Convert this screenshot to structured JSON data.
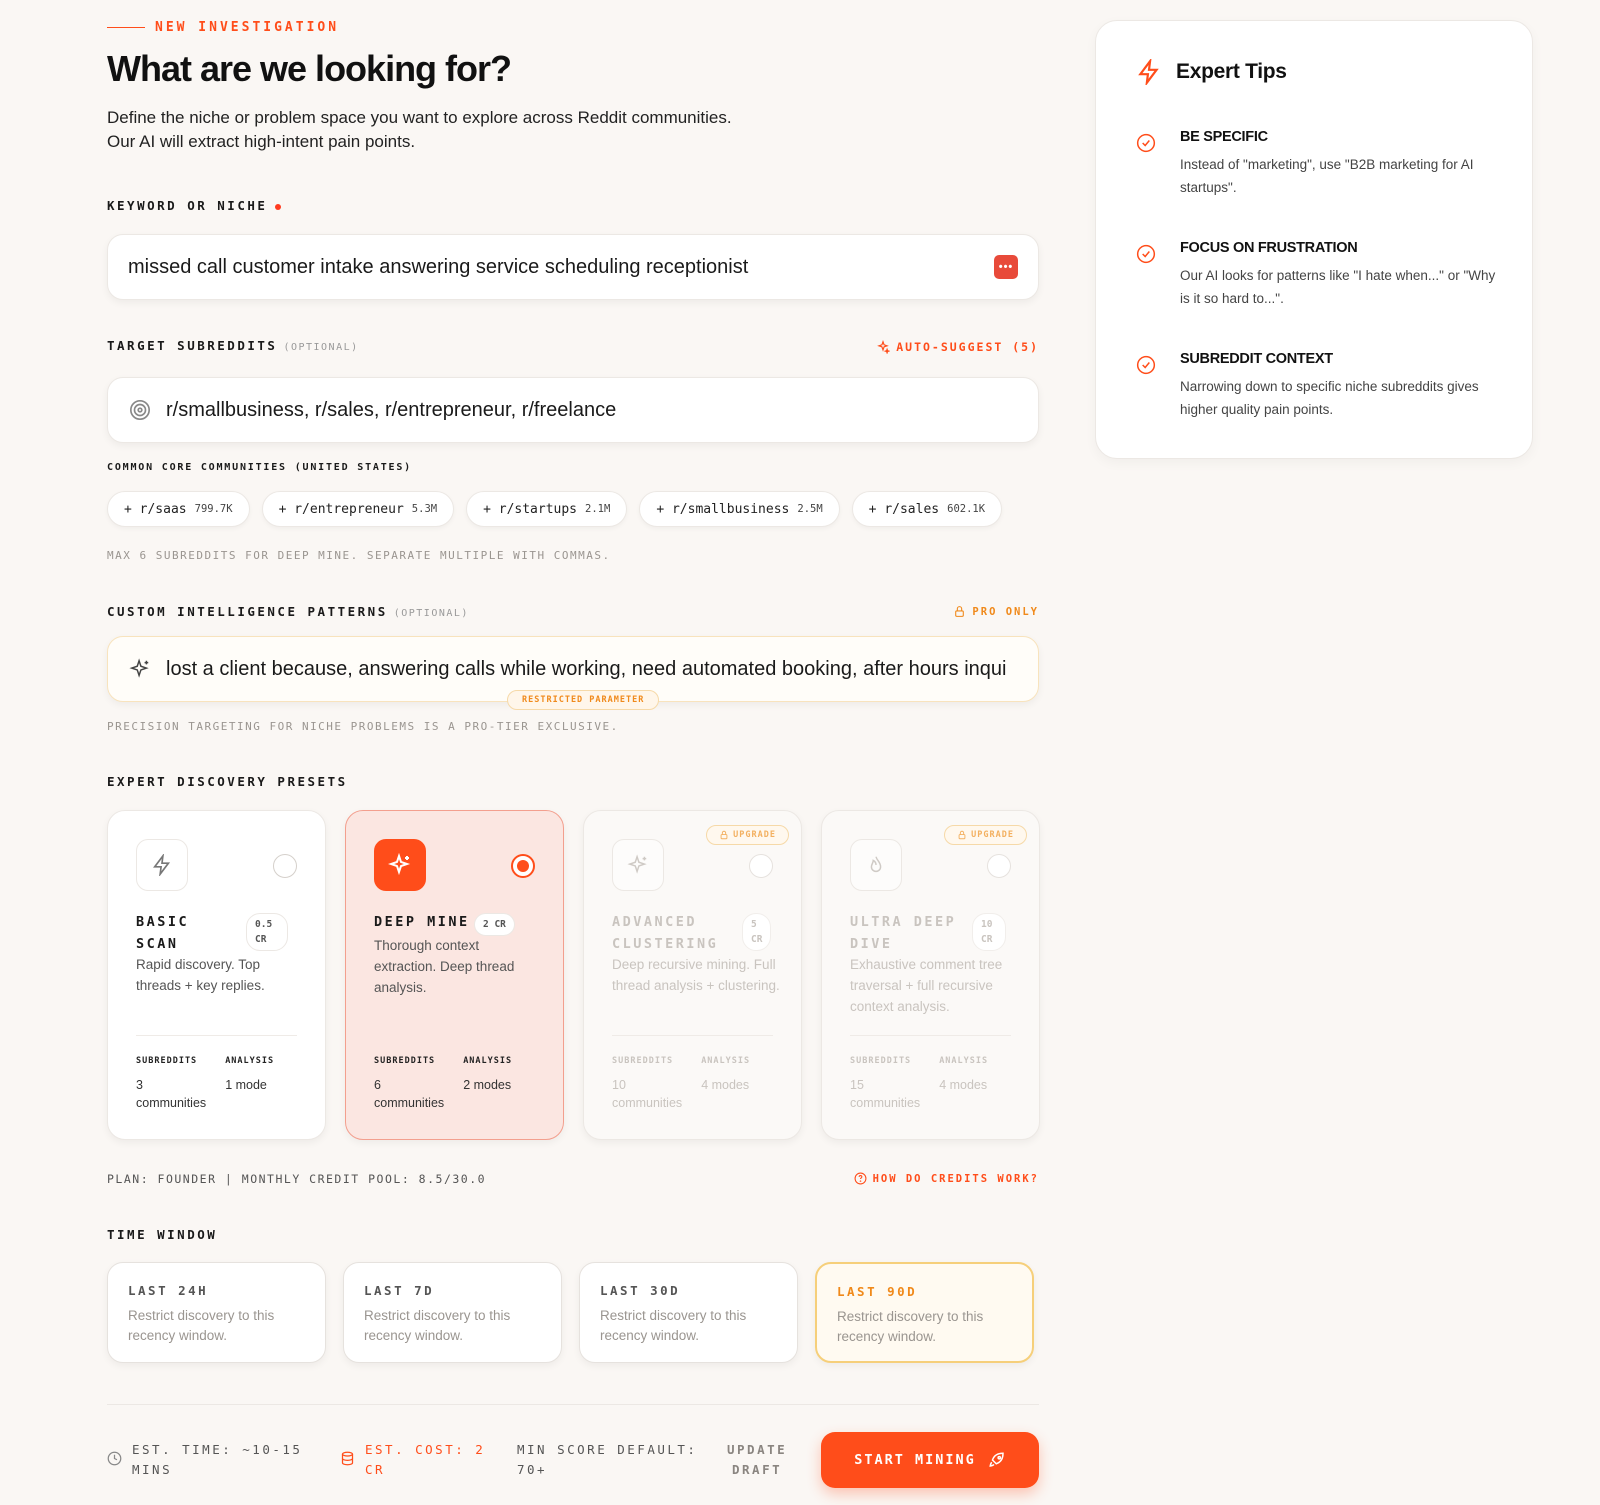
{
  "header": {
    "eyebrow": "NEW INVESTIGATION",
    "title": "What are we looking for?",
    "subtitle_line1": "Define the niche or problem space you want to explore across Reddit communities.",
    "subtitle_line2": "Our AI will extract high-intent pain points."
  },
  "keyword": {
    "label": "KEYWORD OR NICHE",
    "value": "missed call customer intake answering service scheduling receptionist",
    "badge": "•••"
  },
  "subreddits": {
    "label": "TARGET SUBREDDITS",
    "optional": "(OPTIONAL)",
    "auto_suggest": "AUTO-SUGGEST (5)",
    "value": "r/smallbusiness, r/sales, r/entrepreneur, r/freelance",
    "common_label": "COMMON CORE COMMUNITIES (UNITED STATES)",
    "chips": [
      {
        "name": "+ r/saas",
        "count": "799.7K"
      },
      {
        "name": "+ r/entrepreneur",
        "count": "5.3M"
      },
      {
        "name": "+ r/startups",
        "count": "2.1M"
      },
      {
        "name": "+ r/smallbusiness",
        "count": "2.5M"
      },
      {
        "name": "+ r/sales",
        "count": "602.1K"
      }
    ],
    "note": "MAX 6 SUBREDDITS FOR DEEP MINE. SEPARATE MULTIPLE WITH COMMAS."
  },
  "patterns": {
    "label": "CUSTOM INTELLIGENCE PATTERNS",
    "optional": "(OPTIONAL)",
    "pro_only": "PRO ONLY",
    "value": "lost a client because, answering calls while working, need automated booking, after hours inqui",
    "restricted": "RESTRICTED PARAMETER",
    "note": "PRECISION TARGETING FOR NICHE PROBLEMS IS A PRO-TIER EXCLUSIVE."
  },
  "presets": {
    "label": "EXPERT DISCOVERY PRESETS",
    "cards": [
      {
        "title1": "BASIC",
        "title2": "SCAN",
        "cr1": "0.5",
        "cr2": "CR",
        "desc": "Rapid discovery. Top threads + key replies.",
        "k1": "SUBREDDITS",
        "v1a": "3",
        "v1b": "communities",
        "k2": "ANALYSIS",
        "v2": "1 mode"
      },
      {
        "title1": "DEEP MINE",
        "title2": "",
        "cr1": "2 CR",
        "cr2": "",
        "desc": "Thorough context extraction. Deep thread analysis.",
        "k1": "SUBREDDITS",
        "v1a": "6",
        "v1b": "communities",
        "k2": "ANALYSIS",
        "v2": "2 modes"
      },
      {
        "title1": "ADVANCED",
        "title2": "CLUSTERING",
        "cr1": "5",
        "cr2": "CR",
        "desc": "Deep recursive mining. Full thread analysis + clustering.",
        "k1": "SUBREDDITS",
        "v1a": "10",
        "v1b": "communities",
        "k2": "ANALYSIS",
        "v2": "4 modes",
        "upgrade": "UPGRADE"
      },
      {
        "title1": "ULTRA DEEP",
        "title2": "DIVE",
        "cr1": "10",
        "cr2": "CR",
        "desc": "Exhaustive comment tree traversal + full recursive context analysis.",
        "k1": "SUBREDDITS",
        "v1a": "15",
        "v1b": "communities",
        "k2": "ANALYSIS",
        "v2": "4 modes",
        "upgrade": "UPGRADE"
      }
    ]
  },
  "plan": {
    "text": "PLAN: FOUNDER | MONTHLY CREDIT POOL: 8.5/30.0",
    "credits_link": "HOW DO CREDITS WORK?"
  },
  "time_window": {
    "label": "TIME WINDOW",
    "options": [
      {
        "title": "LAST 24H",
        "desc": "Restrict discovery to this recency window."
      },
      {
        "title": "LAST 7D",
        "desc": "Restrict discovery to this recency window."
      },
      {
        "title": "LAST 30D",
        "desc": "Restrict discovery to this recency window."
      },
      {
        "title": "LAST 90D",
        "desc": "Restrict discovery to this recency window."
      }
    ],
    "selected": "LAST 90D"
  },
  "footer": {
    "time_line1": "EST. TIME: ~10-15",
    "time_line2": "MINS",
    "cost_line1": "EST. COST: 2",
    "cost_line2": "CR",
    "score_line1": "MIN SCORE DEFAULT:",
    "score_line2": "70+",
    "draft_line1": "UPDATE",
    "draft_line2": "DRAFT",
    "start": "START MINING"
  },
  "tips": {
    "title": "Expert Tips",
    "items": [
      {
        "title": "BE SPECIFIC",
        "desc": "Instead of \"marketing\", use \"B2B marketing for AI startups\"."
      },
      {
        "title": "FOCUS ON FRUSTRATION",
        "desc": "Our AI looks for patterns like \"I hate when...\" or \"Why is it so hard to...\"."
      },
      {
        "title": "SUBREDDIT CONTEXT",
        "desc": "Narrowing down to specific niche subreddits gives higher quality pain points."
      }
    ]
  },
  "colors": {
    "accent": "#ff4d1a",
    "amber": "#f0891a",
    "background": "#faf7f4"
  }
}
